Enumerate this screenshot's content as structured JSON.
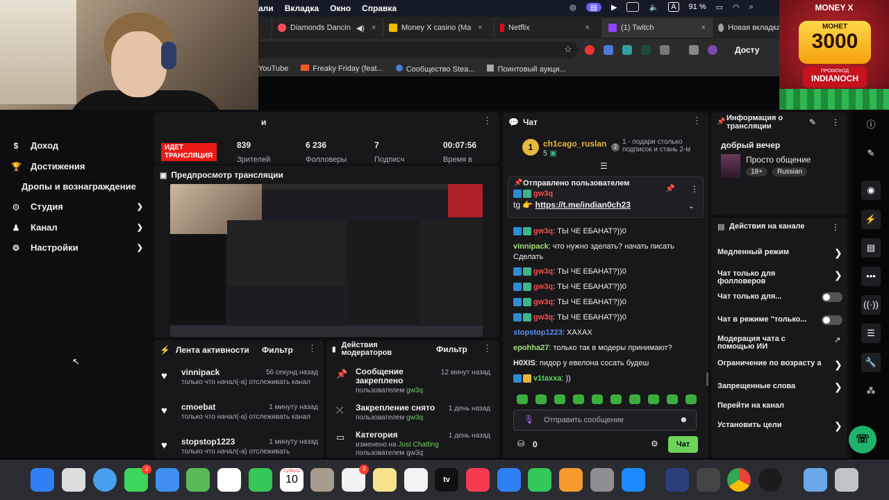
{
  "menubar": {
    "items": [
      "али",
      "Вкладка",
      "Окно",
      "Справка"
    ],
    "battery": "91 %",
    "input_lang": "A"
  },
  "browser": {
    "tabs": [
      {
        "label": "Diamonds Dancin",
        "color": "#ff4b5c"
      },
      {
        "label": "Money X casino (Ma",
        "color": "#f5b800"
      },
      {
        "label": "Netflix",
        "color": "#e50914"
      },
      {
        "label": "(1) Twitch",
        "color": "#9146ff"
      },
      {
        "label": "Новая вкладка",
        "color": "#9aa0a6"
      }
    ],
    "address_tail": "Досту",
    "bookmarks": [
      "YouTube",
      "Freaky Friday (feat...",
      "Сообщество Stea...",
      "Поинтовый аукци..."
    ]
  },
  "casino_ad": {
    "brand": "MONEY X",
    "coins_label": "МОНЕТ",
    "coins_amount": "3000",
    "promo_label": "ПРОМОКОД",
    "promo_code": "INDIANOCH"
  },
  "nav": {
    "items": [
      {
        "label": "Доход",
        "icon": "money-icon",
        "chevron": false
      },
      {
        "label": "Достижения",
        "icon": "trophy-icon",
        "chevron": false
      },
      {
        "label": "Дропы и вознаграждение",
        "icon": "",
        "chevron": false
      },
      {
        "label": "Студия",
        "icon": "studio-icon",
        "chevron": true
      },
      {
        "label": "Канал",
        "icon": "channel-icon",
        "chevron": true
      },
      {
        "label": "Настройки",
        "icon": "gear-icon",
        "chevron": true
      }
    ]
  },
  "stats": {
    "header_partial": "и",
    "live_badge": "ИДЕТ ТРАНСЛЯЦИЯ",
    "viewers_value": "839",
    "viewers_label": "Зрителей",
    "followers_value": "6 236",
    "followers_label": "Фолловеры",
    "subs_value": "7",
    "subs_label": "Подписч",
    "time_value": "00:07:56",
    "time_label": "Время в"
  },
  "preview": {
    "title": "Предпросмотр трансляции"
  },
  "activity": {
    "title": "Лента активности",
    "filter": "Фильтр",
    "items": [
      {
        "name": "vinnipack",
        "time": "56 секунд назад",
        "desc": "только что начал(-а) отслеживать канал"
      },
      {
        "name": "cmoebat",
        "time": "1 минуту назад",
        "desc": "только что начал(-а) отслеживать канал"
      },
      {
        "name": "stopstop1223",
        "time": "1 минуту назад",
        "desc": "только что начал(-а) отслеживать"
      }
    ]
  },
  "mod_actions": {
    "title": "Действия модераторов",
    "filter": "Фильтр",
    "items": [
      {
        "title": "Сообщение закреплено",
        "time": "12 минут назад",
        "sub_prefix": "пользователем",
        "sub_user": "gw3q"
      },
      {
        "title": "Закрепление снято",
        "time": "1 день назад",
        "sub_prefix": "пользователем",
        "sub_user": "gw3q"
      },
      {
        "title": "Категория",
        "time": "1 день назад",
        "sub_prefix": "изменено на",
        "sub_user": "Just Chatting",
        "sub_extra": "пользователем gw3q"
      }
    ]
  },
  "chat": {
    "title": "Чат",
    "leader_name": "ch1cago_ruslan",
    "leader_rank": "1",
    "leader_count": "5",
    "leader_cta_rank": "2",
    "leader_cta": "1 - подари столько подписок и стань 2-м",
    "pinned_label": "Отправлено пользователем",
    "pinned_user": "gw3q",
    "pinned_prefix": "tg",
    "pinned_link": "https://t.me/indian0ch23",
    "messages": [
      {
        "user": "gw3q",
        "color": "r",
        "badges": 2,
        "text": ": ТЫ ЧЕ ЕБАНАТ?))0"
      },
      {
        "user": "vinnipack",
        "color": "gg",
        "badges": 0,
        "text": ": что нужно зделать? начать писать Сделать"
      },
      {
        "user": "gw3q",
        "color": "r",
        "badges": 2,
        "text": ": ТЫ ЧЕ ЕБАНАТ?))0"
      },
      {
        "user": "gw3q",
        "color": "r",
        "badges": 2,
        "text": ": ТЫ ЧЕ ЕБАНАТ?))0"
      },
      {
        "user": "gw3q",
        "color": "r",
        "badges": 2,
        "text": ": ТЫ ЧЕ ЕБАНАТ?))0"
      },
      {
        "user": "gw3q",
        "color": "r",
        "badges": 2,
        "text": ": ТЫ ЧЕ ЕБАНАТ?))0"
      },
      {
        "user": "stopstop1223",
        "color": "b",
        "badges": 0,
        "text": ": ХАХАХ"
      },
      {
        "user": "epohha27",
        "color": "gg",
        "badges": 0,
        "text": ": только так в модеры принимают?"
      },
      {
        "user": "H0XIS",
        "color": "w",
        "badges": 0,
        "text": ": пидор у евелона сосать будеш"
      },
      {
        "user": "v1taxxa",
        "color": "g",
        "badges": 2,
        "text": ": ))"
      }
    ],
    "input_placeholder": "Отправить сообщение",
    "points": "0",
    "send_label": "Чат"
  },
  "stream_info": {
    "title": "Информация о трансляции",
    "stream_title": "добрый вечер",
    "category": "Просто общение",
    "tags": [
      "18+",
      "Russian"
    ]
  },
  "channel_actions": {
    "title": "Действия на канале",
    "rows": [
      {
        "label": "Медленный режим",
        "control": "chevron"
      },
      {
        "label": "Чат только для фолловеров",
        "control": "chevron"
      },
      {
        "label": "Чат только для...",
        "control": "toggle"
      },
      {
        "label": "Чат в режиме \"только...",
        "control": "toggle"
      },
      {
        "label": "Модерация чата с помощью ИИ",
        "control": "external"
      },
      {
        "label": "Ограничение по возрасту а",
        "control": "chevron"
      },
      {
        "label": "Запрещенные слова",
        "control": "chevron"
      },
      {
        "label": "Перейти на канал",
        "control": "none"
      },
      {
        "label": "Установить цели",
        "control": "chevron"
      }
    ]
  },
  "dock": {
    "calendar_month": "Суббота",
    "calendar_day": "10",
    "tv_label": "tv",
    "messages_badge": "2",
    "reminders_badge": "3"
  },
  "colors": {
    "twitch_bg": "#0e0e10",
    "panel_bg": "#18181b",
    "live_red": "#e91916",
    "chat_send_green": "#6dd35a",
    "rail_green": "#1fb26b"
  }
}
